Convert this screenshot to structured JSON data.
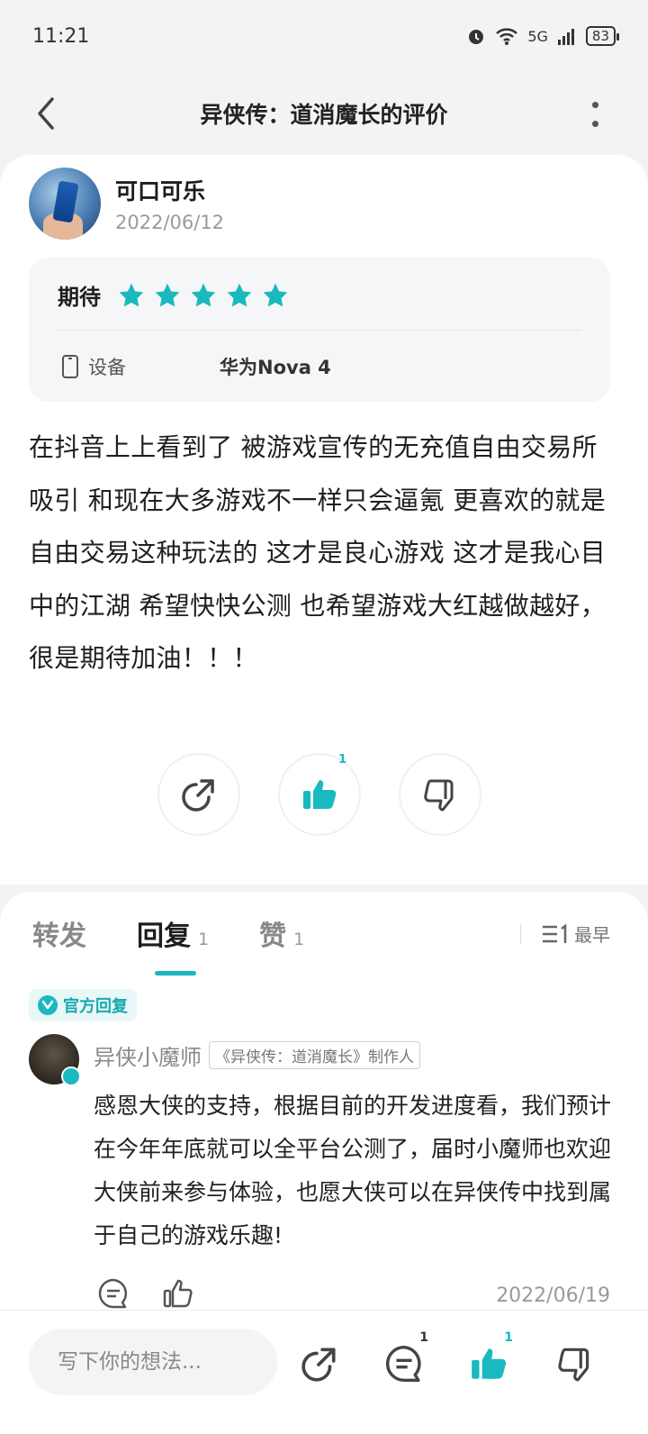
{
  "status_bar": {
    "time": "11:21",
    "network": "5G",
    "battery": "83"
  },
  "header": {
    "title": "异侠传：道消魔长的评价"
  },
  "review": {
    "author_name": "可口可乐",
    "date": "2022/06/12",
    "rating_label": "期待",
    "stars": 5,
    "device_label": "设备",
    "device_value": "华为Nova 4",
    "text": "在抖音上上看到了 被游戏宣传的无充值自由交易所吸引 和现在大多游戏不一样只会逼氪 更喜欢的就是自由交易这种玩法的 这才是良心游戏 这才是我心目中的江湖 希望快快公测 也希望游戏大红越做越好，很是期待加油！！！",
    "like_count": "1"
  },
  "tabs": [
    {
      "label": "转发",
      "count": ""
    },
    {
      "label": "回复",
      "count": "1"
    },
    {
      "label": "赞",
      "count": "1"
    }
  ],
  "sort": {
    "label": "最早"
  },
  "official_reply": {
    "badge": "官方回复",
    "name": "异侠小魔师",
    "role": "《异侠传：道消魔长》制作人",
    "text": "感恩大侠的支持，根据目前的开发进度看，我们预计在今年年底就可以全平台公测了，届时小魔师也欢迎大侠前来参与体验，也愿大侠可以在异侠传中找到属于自己的游戏乐趣!",
    "date": "2022/06/19"
  },
  "bottom_bar": {
    "input_placeholder": "写下你的想法...",
    "comment_count": "1",
    "like_count": "1"
  },
  "colors": {
    "accent": "#19b9c0",
    "background": "#f2f3f5"
  }
}
